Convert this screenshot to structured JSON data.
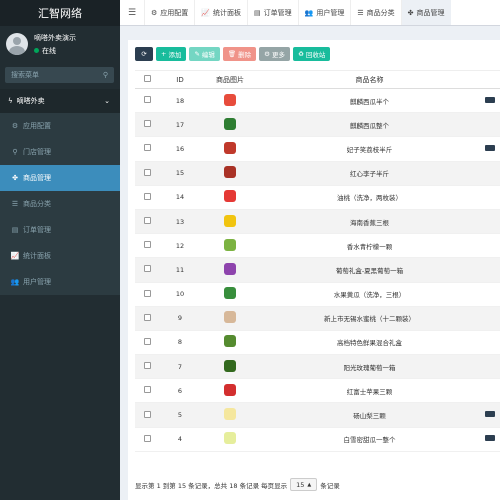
{
  "brand": "汇智网络",
  "user": {
    "name": "嘀嗒外卖演示",
    "status": "在线"
  },
  "search": {
    "placeholder": "搜索菜单"
  },
  "menu": {
    "header": "嘀嗒外卖",
    "items": [
      {
        "label": "应用配置",
        "icon": "gear-icon",
        "glyph": "⚙"
      },
      {
        "label": "门店管理",
        "icon": "location-icon",
        "glyph": "⚲"
      },
      {
        "label": "商品管理",
        "icon": "cubes-icon",
        "glyph": "✤",
        "active": true
      },
      {
        "label": "商品分类",
        "icon": "list-icon",
        "glyph": "☰"
      },
      {
        "label": "订单管理",
        "icon": "file-icon",
        "glyph": "▤"
      },
      {
        "label": "统计面板",
        "icon": "chart-icon",
        "glyph": "📈"
      },
      {
        "label": "用户管理",
        "icon": "users-icon",
        "glyph": "👥"
      }
    ]
  },
  "tabs": [
    {
      "label": "应用配置",
      "icon": "gear-icon",
      "glyph": "⚙"
    },
    {
      "label": "统计面板",
      "icon": "chart-icon",
      "glyph": "📈"
    },
    {
      "label": "订单管理",
      "icon": "file-icon",
      "glyph": "▤"
    },
    {
      "label": "用户管理",
      "icon": "users-icon",
      "glyph": "👥"
    },
    {
      "label": "商品分类",
      "icon": "list-icon",
      "glyph": "☰"
    },
    {
      "label": "商品管理",
      "icon": "cubes-icon",
      "glyph": "✤",
      "active": true
    }
  ],
  "toolbar": {
    "add": "添加",
    "edit": "编辑",
    "delete": "删除",
    "more": "更多",
    "recycle": "回收站"
  },
  "table": {
    "columns": [
      "ID",
      "商品图片",
      "商品名称"
    ],
    "rows": [
      {
        "id": "18",
        "name": "麒麟西瓜半个",
        "color": "#e74c3c",
        "op": true
      },
      {
        "id": "17",
        "name": "麒麟西瓜整个",
        "color": "#2e7d32",
        "op": false
      },
      {
        "id": "16",
        "name": "妃子笑荔枝半斤",
        "color": "#c0392b",
        "op": true
      },
      {
        "id": "15",
        "name": "红心李子半斤",
        "color": "#a93226",
        "op": false
      },
      {
        "id": "14",
        "name": "油桃（洗净，两枚装）",
        "color": "#e53935",
        "op": false
      },
      {
        "id": "13",
        "name": "海南香蕉三根",
        "color": "#f1c40f",
        "op": false
      },
      {
        "id": "12",
        "name": "香水青柠檬一颗",
        "color": "#7cb342",
        "op": false
      },
      {
        "id": "11",
        "name": "葡萄礼盒-夏黑葡萄一箱",
        "color": "#8e44ad",
        "op": false
      },
      {
        "id": "10",
        "name": "水果黄瓜（洗净，三根）",
        "color": "#388e3c",
        "op": false
      },
      {
        "id": "9",
        "name": "新上市无锡水蜜桃（十二颗装）",
        "color": "#d7b899",
        "op": false
      },
      {
        "id": "8",
        "name": "高档特色鲜果混合礼盒",
        "color": "#558b2f",
        "op": false
      },
      {
        "id": "7",
        "name": "阳光玫瑰葡萄一箱",
        "color": "#33691e",
        "op": false
      },
      {
        "id": "6",
        "name": "红富士苹果三颗",
        "color": "#d32f2f",
        "op": false
      },
      {
        "id": "5",
        "name": "砀山梨三颗",
        "color": "#f5e79e",
        "op": true
      },
      {
        "id": "4",
        "name": "白雪密甜瓜一整个",
        "color": "#e6ee9c",
        "op": true
      }
    ]
  },
  "footer": {
    "summary": "显示第 1 到第 15 条记录，总共 18 条记录 每页显示",
    "page_size": "15",
    "suffix": "条记录"
  }
}
